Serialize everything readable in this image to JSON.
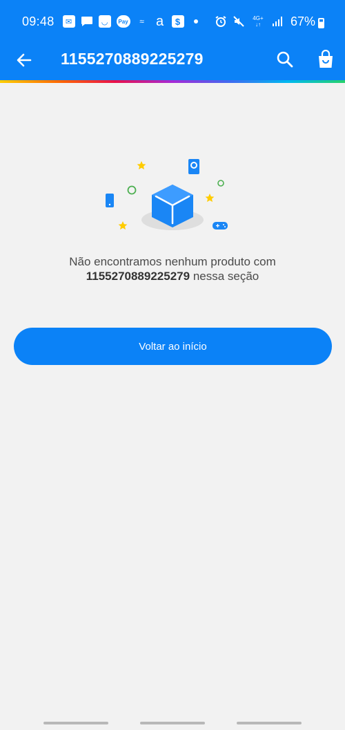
{
  "status_bar": {
    "time": "09:48",
    "battery_percent": "67%",
    "network_label": "4G+",
    "pay_label": "Pay",
    "icons": [
      "mail-icon",
      "chat-icon",
      "shop-icon",
      "pay-icon",
      "wave-icon",
      "amazon-icon",
      "dollar-icon",
      "dot-icon",
      "alarm-icon",
      "mute-icon",
      "network-icon",
      "signal-icon",
      "battery-icon"
    ]
  },
  "toolbar": {
    "title": "1155270889225279",
    "back_icon": "arrow-left-icon",
    "search_icon": "search-icon",
    "bag_icon": "shopping-bag-icon"
  },
  "empty_state": {
    "message_line1": "Não encontramos nenhum produto com",
    "query": "1155270889225279",
    "message_suffix": "nessa seção",
    "icons": [
      "box-icon",
      "star-icon",
      "phone-icon",
      "book-icon",
      "gamepad-icon",
      "circle-icon"
    ]
  },
  "home_button": {
    "label": "Voltar ao início"
  },
  "colors": {
    "primary": "#0b82f7",
    "background": "#f2f2f2",
    "star": "#ffcc00",
    "circle_outline": "#4caf50"
  }
}
